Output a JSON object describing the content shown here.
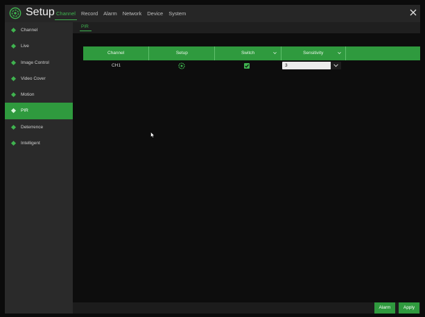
{
  "app": {
    "title": "Setup"
  },
  "nav": {
    "items": [
      "Channel",
      "Record",
      "Alarm",
      "Network",
      "Device",
      "System"
    ],
    "active": "Channel"
  },
  "sidebar": {
    "items": [
      "Channel",
      "Live",
      "Image Control",
      "Video Cover",
      "Motion",
      "PIR",
      "Deterrence",
      "Intelligent"
    ],
    "active": "PIR"
  },
  "subtabs": {
    "active": "PIR"
  },
  "table": {
    "headers": {
      "channel": "Channel",
      "setup": "Setup",
      "switch": "Switch",
      "sensitivity": "Sensitivity"
    },
    "rows": [
      {
        "channel": "CH1",
        "switch_checked": true,
        "sensitivity": "3"
      }
    ]
  },
  "footer": {
    "alarm_label": "Alarm",
    "apply_label": "Apply"
  },
  "colors": {
    "accent": "#2f9a3e",
    "accent_text": "#3fb34f",
    "sidebar_bg": "#2a2a2a",
    "topbar_bg": "#262626"
  },
  "icons": {
    "logo": "gear-logo-icon",
    "close": "close-icon",
    "setup": "gear-icon",
    "dropdown": "chevron-down-icon",
    "check": "checkbox-checked-icon",
    "cursor": "mouse-pointer-icon"
  }
}
